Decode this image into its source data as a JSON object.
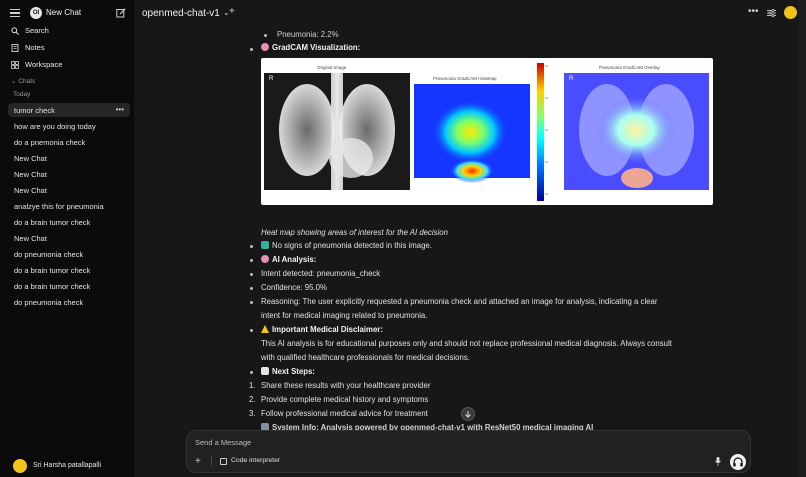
{
  "sidebar": {
    "new_chat": "New Chat",
    "nav": [
      {
        "label": "Search",
        "icon": "search-icon"
      },
      {
        "label": "Notes",
        "icon": "notes-icon"
      },
      {
        "label": "Workspace",
        "icon": "workspace-icon"
      }
    ],
    "chats_label": "Chats",
    "today_label": "Today",
    "items": [
      "tumor check",
      "how are you doing today",
      "do a pnemonia check",
      "New Chat",
      "New Chat",
      "New Chat",
      "analzye this for pneumonia",
      "do a brain tumor check",
      "New Chat",
      "do pneumonia check",
      "do a brain tumor check",
      "do a brain tumor check",
      "do pneumonia check"
    ],
    "active_index": 0,
    "user_name": "Sri Harsha patallapalli"
  },
  "header": {
    "model": "openmed-chat-v1"
  },
  "message": {
    "faded_top": "Pneumonia: 2.2%",
    "gradcam_heading": "GradCAM Visualization:",
    "panel_titles": [
      "Original Image",
      "Pneumonia GradCAM Heatmap",
      "Pneumonia GradCAM Overlay"
    ],
    "caption": "Heat map showing areas of interest for the AI decision",
    "no_signs": "No signs of pneumonia detected in this image.",
    "ai_analysis": "AI Analysis:",
    "intent": "Intent detected: pneumonia_check",
    "confidence": "Confidence: 95.0%",
    "reasoning_label": "Reasoning:",
    "reasoning_1": " The user explicitly requested a pneumonia check and attached an image for analysis, indicating a clear",
    "reasoning_2": "intent for medical imaging related to pneumonia.",
    "disclaimer_heading": "Important Medical Disclaimer:",
    "disclaimer_1": "This AI analysis is for educational purposes only and should not replace professional medical diagnosis. Always consult",
    "disclaimer_2": "with qualified healthcare professionals for medical decisions.",
    "next_steps": "Next Steps:",
    "steps": [
      "Share these results with your healthcare provider",
      "Provide complete medical history and symptoms",
      "Follow professional medical advice for treatment"
    ],
    "system_info": "System Info: Analysis powered by openmed-chat-v1 with ResNet50 medical imaging AI"
  },
  "composer": {
    "placeholder": "Send a Message",
    "code_interpreter": "Code interpreter"
  },
  "colors": {
    "accent_avatar": "#f0c419",
    "check_green": "#2fb39a",
    "warning_yellow": "#f5c518",
    "brain_pink": "#e88fb6"
  }
}
